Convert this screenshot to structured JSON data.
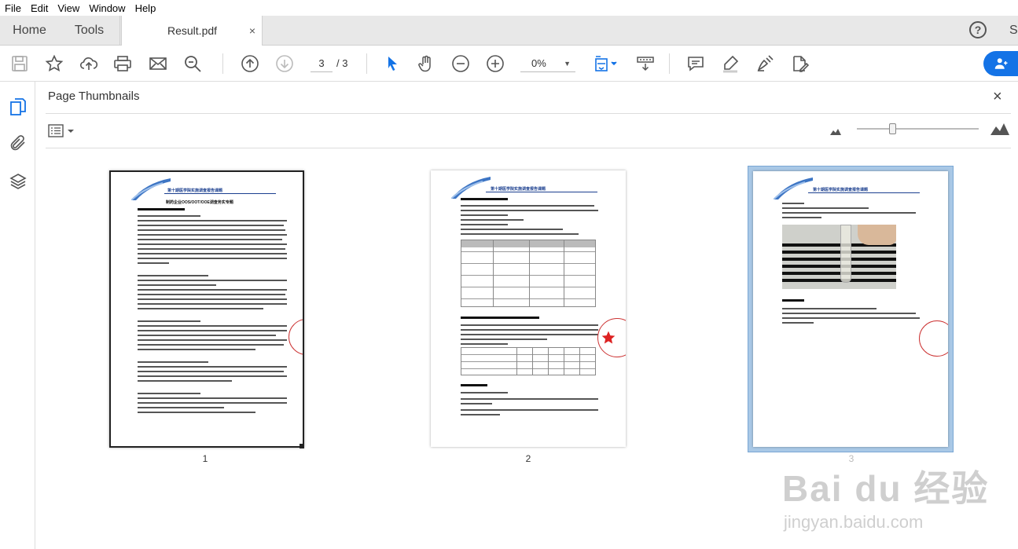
{
  "menu": [
    "File",
    "Edit",
    "View",
    "Window",
    "Help"
  ],
  "tabs": {
    "home": "Home",
    "tools": "Tools",
    "document": "Result.pdf",
    "close": "×"
  },
  "header": {
    "help": "?",
    "signin": "S"
  },
  "toolbar": {
    "page_current": "3",
    "page_total": "/ 3",
    "zoom": "0%",
    "zoom_caret": "▼"
  },
  "panel": {
    "title": "Page Thumbnails",
    "close": "×"
  },
  "thumbnails": [
    {
      "label": "1",
      "header": "第十期医学院实施调查报告课题",
      "title": "制药企业OOS/OOT/OOE调查务实专题",
      "selected": false,
      "current": false
    },
    {
      "label": "2",
      "header": "第十期医学院实施调查报告课题",
      "selected": false,
      "current": false
    },
    {
      "label": "3",
      "header": "第十期医学院实施调查报告课题",
      "selected": true,
      "current": true
    }
  ],
  "watermark": {
    "brand": "Bai du 经验",
    "url": "jingyan.baidu.com"
  },
  "colors": {
    "accent": "#1473e6",
    "selection": "#7aa7d4",
    "seal": "#cc3333",
    "header_blue": "#1b3f8f"
  }
}
